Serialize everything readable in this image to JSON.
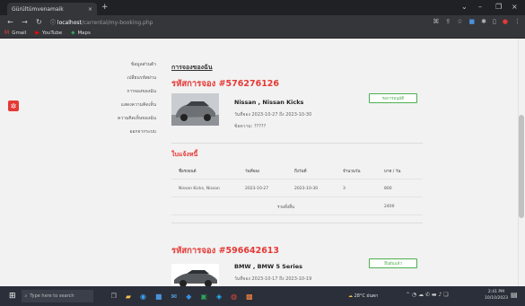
{
  "browser": {
    "tab_title": "Gürültümvenamaik",
    "tab_close": "×",
    "new_tab": "+",
    "window_controls": [
      "⌄",
      "–",
      "❐",
      "×"
    ],
    "url_host": "localhost",
    "url_path": "/carrental/my-booking.php",
    "bookmarks": [
      {
        "label": "Gmail",
        "icon": "gmail-icon"
      },
      {
        "label": "YouTube",
        "icon": "youtube-icon"
      },
      {
        "label": "Maps",
        "icon": "maps-icon"
      }
    ]
  },
  "sidebar": {
    "items": [
      {
        "label": "ข้อมูลส่วนตัว"
      },
      {
        "label": "เปลี่ยนรหัสผ่าน"
      },
      {
        "label": "การจองของฉัน"
      },
      {
        "label": "แสดงความคิดเห็น"
      },
      {
        "label": "ความคิดเห็นของฉัน"
      },
      {
        "label": "ออกจากระบบ"
      }
    ]
  },
  "main": {
    "page_title": "การจองของฉัน",
    "bookings": [
      {
        "code": "รหัสการจอง #576276126",
        "car": "Nissan , Nissan Kicks",
        "dates": "วันที่จอง 2023-10-27 ถึง 2023-10-30",
        "status": "ข้อความ: ?????",
        "button": "รอการอนุมัติ",
        "car_color": "#8a8c90"
      },
      {
        "code": "รหัสการจอง #596642613",
        "car": "BMW , BMW 5 Series",
        "dates": "วันที่จอง 2023-10-17 ถึง 2023-10-19",
        "button": "ยืนยันแล้ว",
        "car_color": "#5a5d62"
      }
    ],
    "invoice": {
      "title": "ใบแจ้งหนี้",
      "headers": [
        "ชื่อรถยนต์",
        "วันที่จอง",
        "ถึงวันที่",
        "จำนวนวัน",
        "บาท / วัน"
      ],
      "row": [
        "Nissan Kicks, Nissan",
        "2023-10-27",
        "2023-10-30",
        "3",
        "800"
      ],
      "total_label": "รวมทั้งสิ้น",
      "total_value": "2400"
    }
  },
  "taskbar": {
    "search_placeholder": "Type here to search",
    "weather": "28°C ฝนตก",
    "time": "2:41 PM",
    "date": "10/10/2023"
  },
  "colors": {
    "accent_red": "#e53935",
    "accent_green": "#4caf50"
  }
}
